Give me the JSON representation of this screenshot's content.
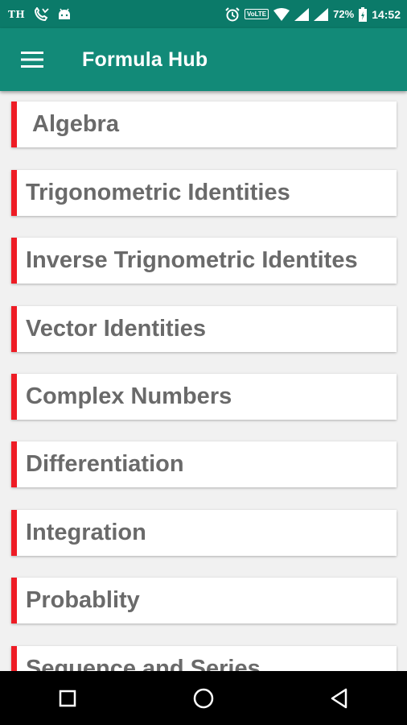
{
  "status_bar": {
    "carrier": "TH",
    "volte": "VoLTE",
    "battery": "72%",
    "time": "14:52",
    "icons": [
      "missed-call-icon",
      "android-icon",
      "alarm-icon",
      "wifi-icon",
      "signal-icon",
      "battery-charging-icon"
    ]
  },
  "app_bar": {
    "title": "Formula Hub",
    "menu_icon": "hamburger-menu-icon"
  },
  "colors": {
    "status_bar": "#0b7a69",
    "app_bar": "#128a78",
    "accent_bar": "#ee1c25",
    "card_text": "#6a6a6a",
    "background": "#f1f1f1"
  },
  "topics": [
    {
      "label": "Algebra"
    },
    {
      "label": "Trigonometric Identities"
    },
    {
      "label": "Inverse Trignometric Identites"
    },
    {
      "label": "Vector Identities"
    },
    {
      "label": "Complex Numbers"
    },
    {
      "label": "Differentiation"
    },
    {
      "label": "Integration"
    },
    {
      "label": "Probablity"
    },
    {
      "label": "Sequence and Series"
    }
  ],
  "nav_bar": {
    "icons": [
      "recents-square-icon",
      "home-circle-icon",
      "back-triangle-icon"
    ]
  }
}
